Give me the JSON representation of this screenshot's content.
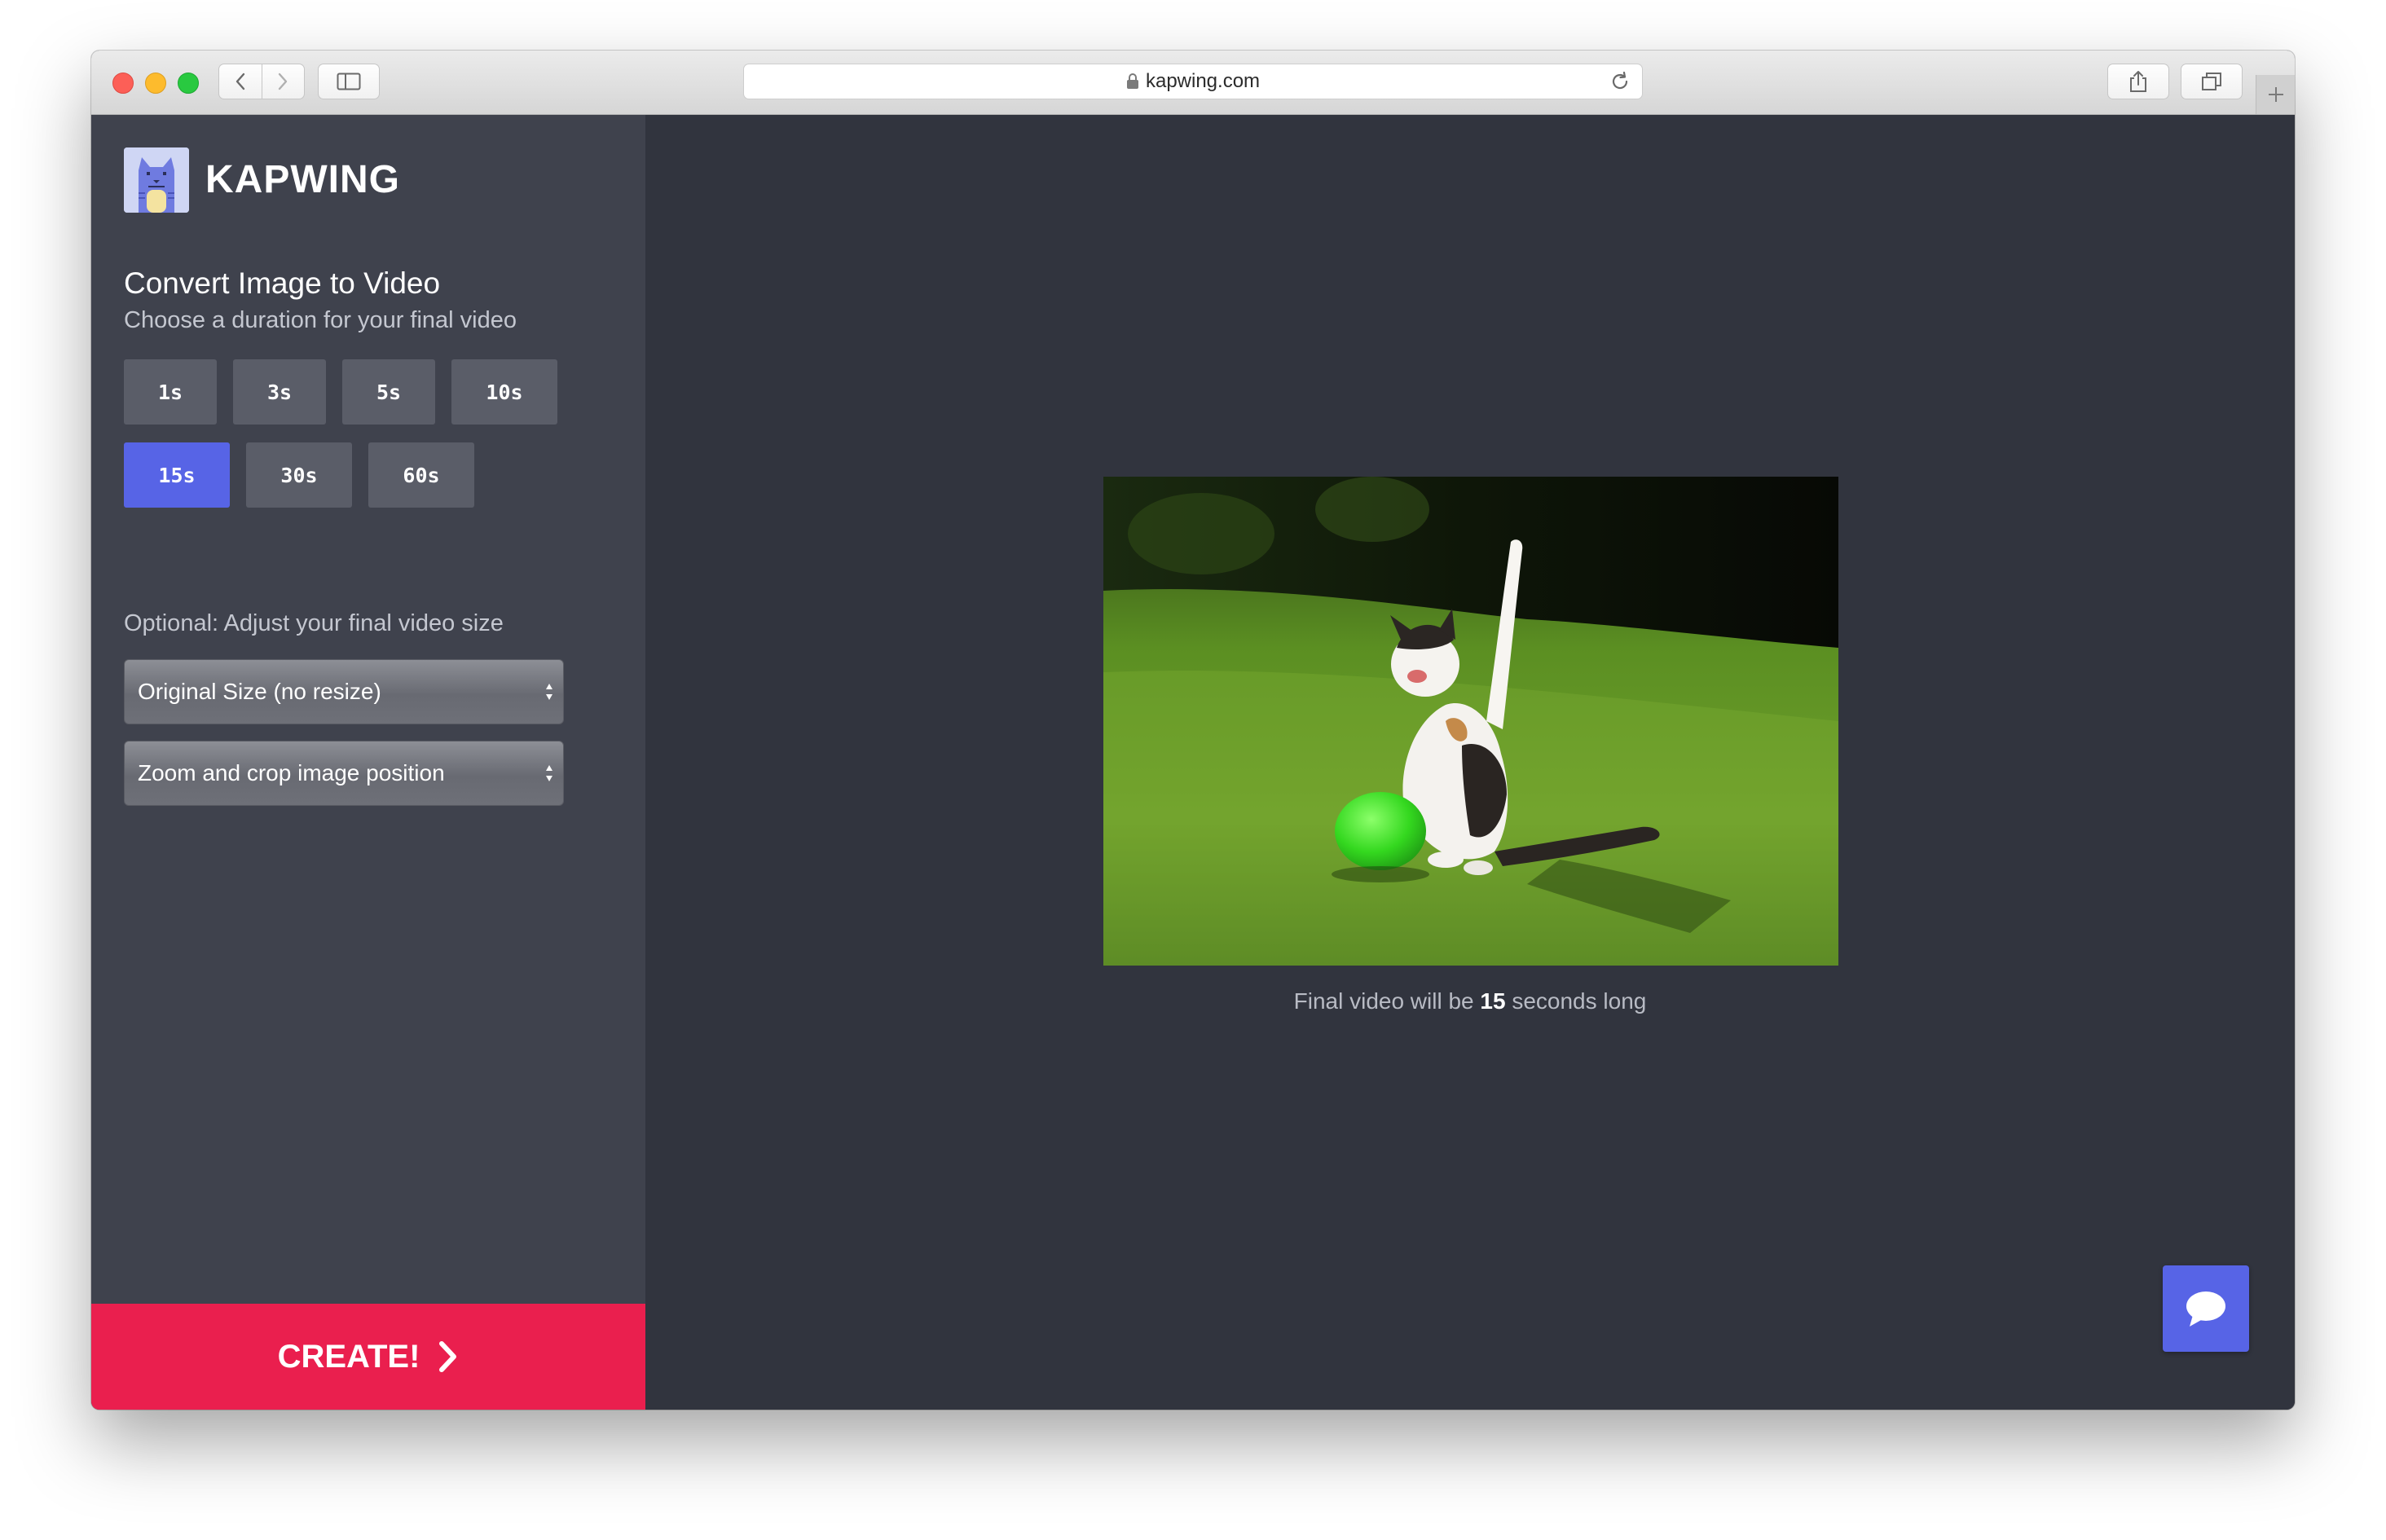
{
  "browser": {
    "url": "kapwing.com",
    "icons": {
      "back": "chevron-left-icon",
      "forward": "chevron-right-icon",
      "sidebar": "sidebar-icon",
      "lock": "lock-icon",
      "reload": "reload-icon",
      "share": "share-icon",
      "tabs": "tabs-overview-icon",
      "new_tab": "plus-icon"
    }
  },
  "brand": {
    "name": "KAPWING"
  },
  "tool": {
    "title": "Convert Image to Video",
    "subtitle": "Choose a duration for your final video",
    "durations": [
      {
        "label": "1s",
        "selected": false
      },
      {
        "label": "3s",
        "selected": false
      },
      {
        "label": "5s",
        "selected": false
      },
      {
        "label": "10s",
        "selected": false
      },
      {
        "label": "15s",
        "selected": true
      },
      {
        "label": "30s",
        "selected": false
      },
      {
        "label": "60s",
        "selected": false
      }
    ],
    "size_label": "Optional: Adjust your final video size",
    "size_select": {
      "value": "Original Size (no resize)"
    },
    "crop_select": {
      "value": "Zoom and crop image position"
    },
    "create_label": "CREATE!"
  },
  "preview": {
    "caption_prefix": "Final video will be",
    "duration_value": "15",
    "caption_suffix": "seconds long"
  },
  "colors": {
    "accent": "#5764e6",
    "create": "#ea1f4e",
    "panel": "#3f424d",
    "main": "#31343e"
  }
}
